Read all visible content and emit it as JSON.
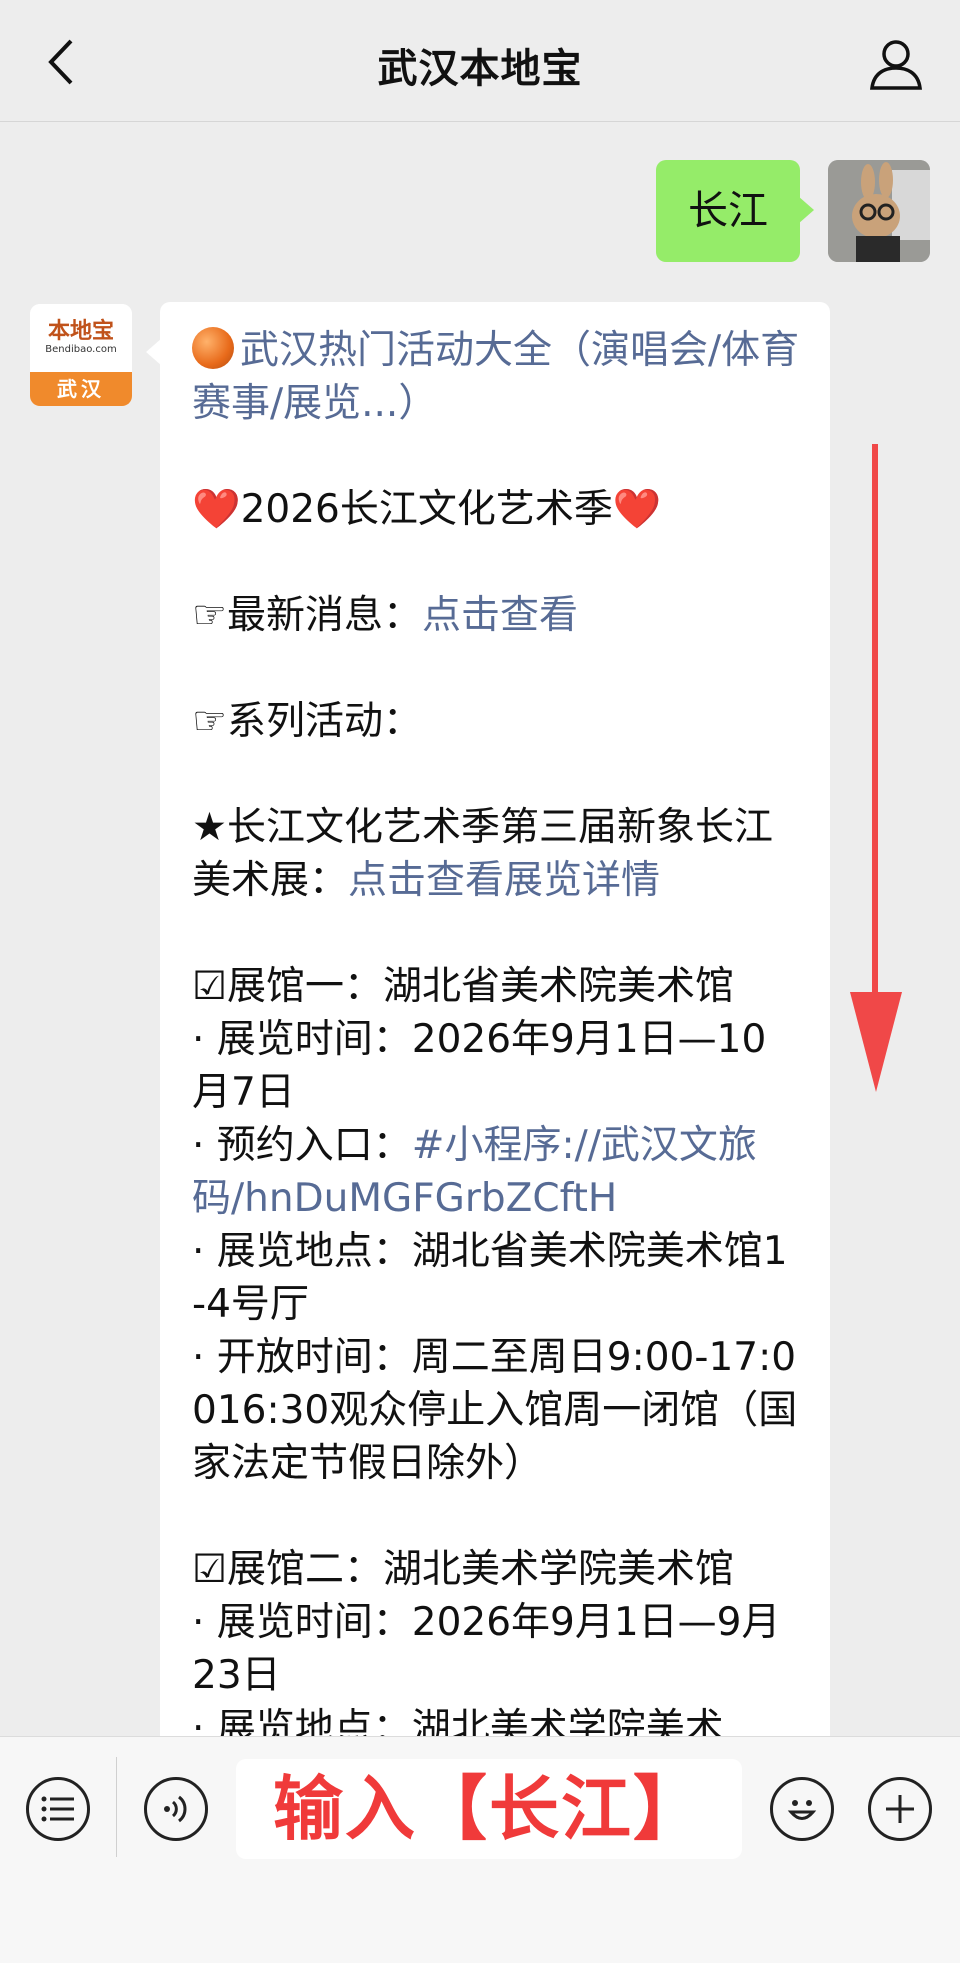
{
  "header": {
    "title": "武汉本地宝",
    "back_icon": "chevron-left-icon",
    "profile_icon": "user-icon"
  },
  "messages": {
    "outgoing": {
      "text": "长江"
    },
    "incoming": {
      "avatar": {
        "logo_text": "本地宝",
        "logo_url": "Bendibao.com",
        "city": "武汉"
      },
      "headline_link": "武汉热门活动大全（演唱会/体育赛事/展览...）",
      "festival_title": "2026长江文化艺术季",
      "heart": "❤️",
      "latest_prefix": "☞最新消息：",
      "latest_link": "点击查看",
      "series_label": "☞系列活动：",
      "exhibition_title": "★长江文化艺术季第三届新象长江美术展：",
      "exhibition_link": "点击查看展览详情",
      "venue1": {
        "name": "☑展馆一：湖北省美术院美术馆",
        "time": "· 展览时间：2026年9月1日—10月7日",
        "booking_prefix": "· 预约入口：",
        "booking_link": "#小程序://武汉文旅码/hnDuMGFGrbZCftH",
        "location": "· 展览地点：湖北省美术院美术馆1-4号厅",
        "hours": "· 开放时间：周二至周日9:00-17:0016:30观众停止入馆周一闭馆（国家法定节假日除外）"
      },
      "venue2": {
        "name": "☑展馆二：湖北美术学院美术馆",
        "time": "· 展览时间：2026年9月1日—9月23日",
        "location_partial": "· 展览地点：湖北美术学院美术"
      }
    }
  },
  "input_bar": {
    "overlay_text": "输入【长江】",
    "menu_icon": "list-icon",
    "voice_icon": "voice-icon",
    "emoji_icon": "smiley-icon",
    "plus_icon": "plus-icon"
  },
  "colors": {
    "link": "#576b95",
    "outgoing_bubble": "#95ec69",
    "annotation_red": "#f03a3a"
  }
}
